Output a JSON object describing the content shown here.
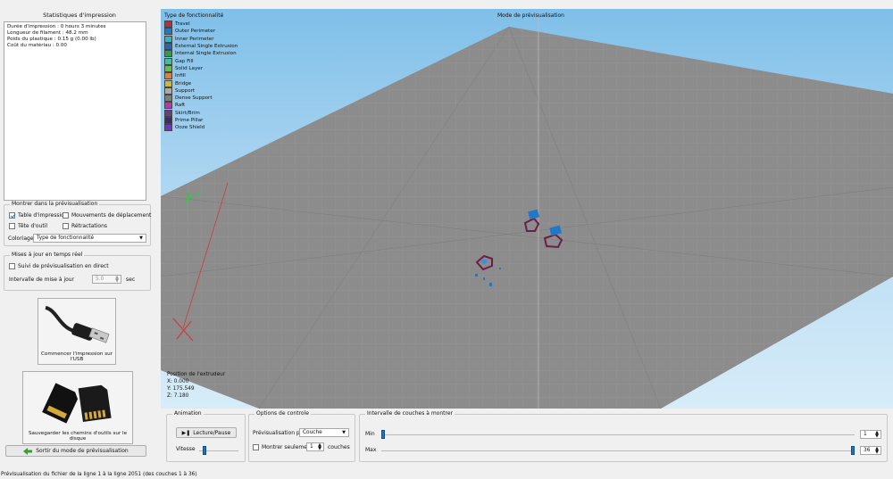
{
  "stats": {
    "title": "Statistiques d'impression",
    "lines": [
      "Durée d'impression : 0 hours 3 minutes",
      "Longueur de filament : 48.2 mm",
      "Poids du plastique : 0.15 g (0.00 lb)",
      "Coût du matériau : 0.00"
    ]
  },
  "show": {
    "title": "Montrer dans la prévisualisation",
    "print_bed": "Table d'impression",
    "travel_moves": "Mouvements de déplacement",
    "tool_head": "Tête d'outil",
    "retractions": "Rétractations",
    "coloring_label": "Coloriage",
    "coloring_value": "Type de fonctionnalité"
  },
  "live": {
    "title": "Mises à jour en temps réel",
    "follow_label": "Suivi de prévisualisation en direct",
    "interval_label": "Intervalle de mise à jour",
    "interval_value": "5.0",
    "unit": "sec"
  },
  "actions": {
    "usb_print": "Commencer l'impression sur l'USB",
    "save_toolpaths": "Sauvegarder les chemins d'outils sur le disque",
    "exit_preview": "Sortir du mode de prévisualisation"
  },
  "viewport": {
    "legend_title": "Type de fonctionnalité",
    "mode_title": "Mode de prévisualisation",
    "legend": [
      {
        "label": "Travel",
        "color": "#b3333d"
      },
      {
        "label": "Outer Perimeter",
        "color": "#1f78c8"
      },
      {
        "label": "Inner Perimeter",
        "color": "#36b3c3"
      },
      {
        "label": "External Single Extrusion",
        "color": "#2466b8"
      },
      {
        "label": "Internal Single Extrusion",
        "color": "#2f9e44"
      },
      {
        "label": "Gap Fill",
        "color": "#3cc19a"
      },
      {
        "label": "Solid Layer",
        "color": "#5cc24a"
      },
      {
        "label": "Infill",
        "color": "#d8853c"
      },
      {
        "label": "Bridge",
        "color": "#c7b93a"
      },
      {
        "label": "Support",
        "color": "#a8aba7"
      },
      {
        "label": "Dense Support",
        "color": "#7b7f7a"
      },
      {
        "label": "Raft",
        "color": "#b936b3"
      },
      {
        "label": "Skirt/Brim",
        "color": "#6b3f7e"
      },
      {
        "label": "Prime Pillar",
        "color": "#3d2b6d"
      },
      {
        "label": "Ooze Shield",
        "color": "#6a35c9"
      }
    ],
    "extruder_title": "Position de l'extrudeur",
    "x": "X: 0.000",
    "y": "Y: 175.549",
    "z": "Z: 7.180"
  },
  "controls": {
    "animation_title": "Animation",
    "play_pause": "Lecture/Pause",
    "speed_label": "Vitesse",
    "speed_level": 0.1,
    "options_title": "Options de controle",
    "preview_by_label": "Prévisualisation par",
    "preview_by_value": "Couche",
    "show_only_label": "Montrer seulement",
    "show_only_value": "1",
    "show_only_unit": "couches",
    "layer_range_title": "Intervalle de couches à montrer",
    "min_label": "Min",
    "min_value": "1",
    "max_label": "Max",
    "max_value": "36"
  },
  "status_bar": "Prévisualisation du fichier de la ligne 1 à la ligne 2051 (des couches 1 à 36)"
}
